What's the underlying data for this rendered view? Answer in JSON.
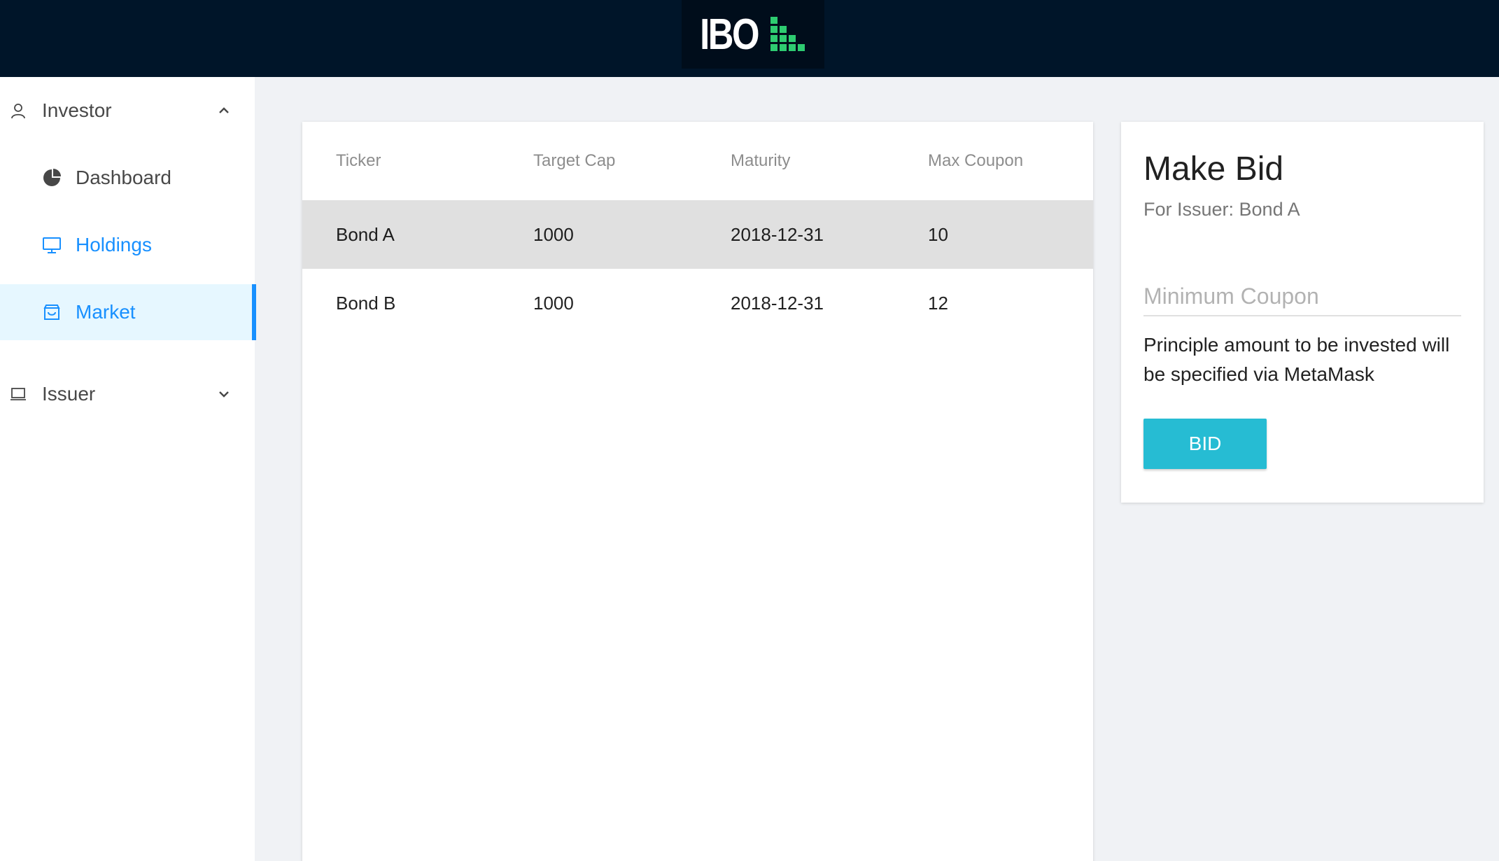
{
  "header": {
    "logo_text": "IBO"
  },
  "sidebar": {
    "investor": {
      "label": "Investor",
      "items": [
        {
          "label": "Dashboard"
        },
        {
          "label": "Holdings"
        },
        {
          "label": "Market"
        }
      ]
    },
    "issuer": {
      "label": "Issuer"
    }
  },
  "table": {
    "columns": [
      "Ticker",
      "Target Cap",
      "Maturity",
      "Max Coupon"
    ],
    "rows": [
      {
        "ticker": "Bond A",
        "target_cap": "1000",
        "maturity": "2018-12-31",
        "max_coupon": "10"
      },
      {
        "ticker": "Bond B",
        "target_cap": "1000",
        "maturity": "2018-12-31",
        "max_coupon": "12"
      }
    ]
  },
  "bid": {
    "title": "Make Bid",
    "subtitle": "For Issuer: Bond A",
    "coupon_placeholder": "Minimum Coupon",
    "note": "Principle amount to be invested will be specified via MetaMask",
    "button_label": "BID"
  },
  "colors": {
    "header_bg": "#001529",
    "accent_blue": "#1890ff",
    "bid_button": "#26bcd3",
    "logo_green": "#2ecc71"
  }
}
